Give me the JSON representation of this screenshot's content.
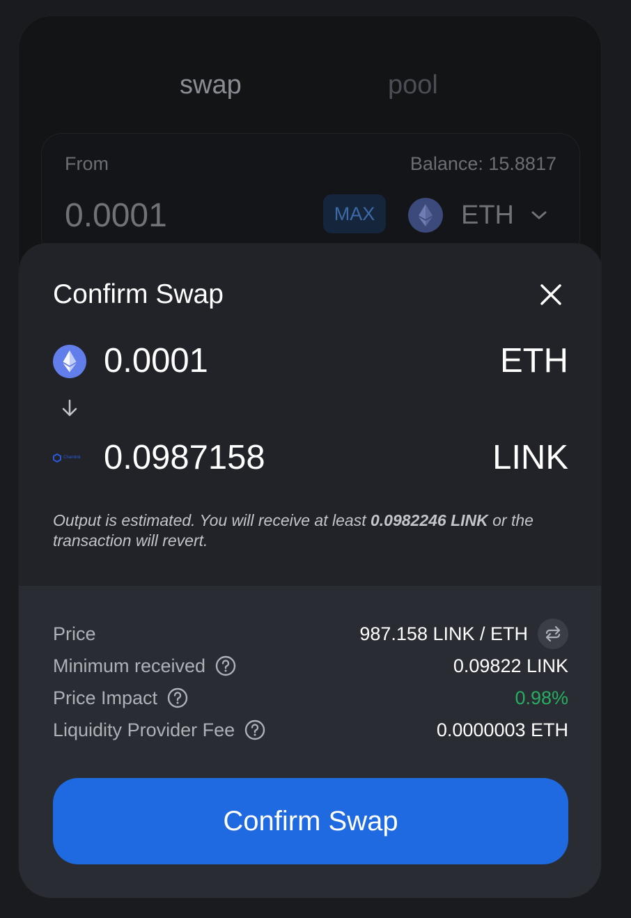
{
  "tabs": {
    "swap": "swap",
    "pool": "pool"
  },
  "from": {
    "label": "From",
    "balance": "Balance: 15.8817",
    "amount": "0.0001",
    "max_label": "MAX",
    "token": "ETH"
  },
  "modal": {
    "title": "Confirm Swap",
    "input": {
      "amount": "0.0001",
      "symbol": "ETH"
    },
    "output": {
      "amount": "0.0987158",
      "symbol": "LINK",
      "icon_text": "Chainlink"
    },
    "note_prefix": "Output is estimated. You will receive at least ",
    "note_bold": "0.0982246 LINK",
    "note_suffix": " or the transaction will revert.",
    "details": {
      "price_label": "Price",
      "price_value": "987.158 LINK / ETH",
      "min_label": "Minimum received",
      "min_value": "0.09822 LINK",
      "impact_label": "Price Impact",
      "impact_value": "0.98%",
      "fee_label": "Liquidity Provider Fee",
      "fee_value": "0.0000003 ETH"
    },
    "confirm_label": "Confirm Swap"
  },
  "colors": {
    "accent": "#1f6ae0",
    "positive": "#27ae60",
    "eth": "#627eea",
    "link": "#2a5ada"
  },
  "icons": [
    "eth-icon",
    "chevron-down-icon",
    "close-icon",
    "arrow-down-icon",
    "chainlink-icon",
    "help-icon",
    "swap-direction-icon"
  ]
}
